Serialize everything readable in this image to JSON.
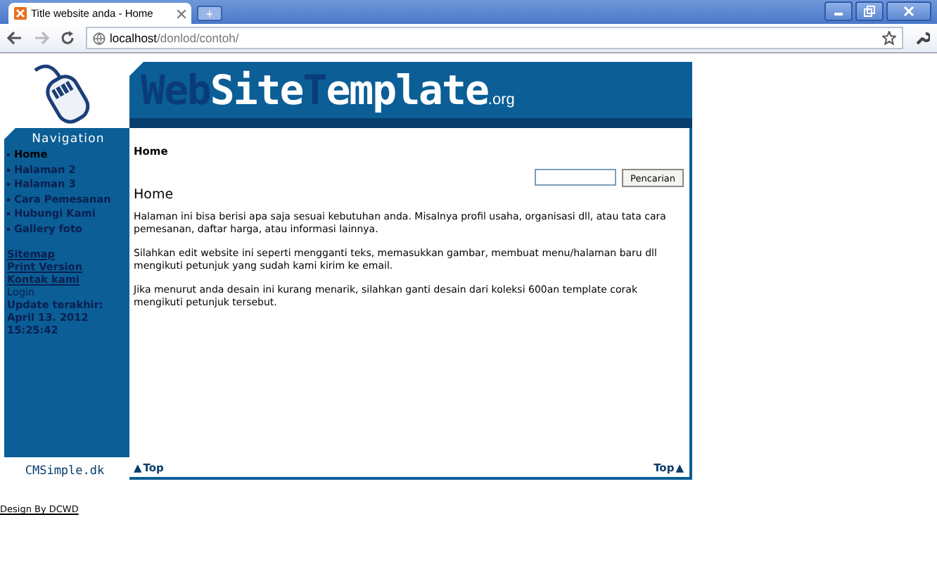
{
  "browser": {
    "tab_title": "Title website anda - Home",
    "new_tab": "+",
    "address_host": "localhost",
    "address_path": "/donlod/contoh/"
  },
  "header": {
    "title_segments": [
      {
        "text": "Web",
        "accent": true
      },
      {
        "text": "Site",
        "accent": false
      },
      {
        "text": "T",
        "accent": true
      },
      {
        "text": "emplate",
        "accent": false
      }
    ],
    "suffix": ".org"
  },
  "navigation": {
    "heading": "Navigation",
    "items": [
      {
        "label": "Home",
        "selected": true
      },
      {
        "label": "Halaman 2",
        "selected": false
      },
      {
        "label": "Halaman 3",
        "selected": false
      },
      {
        "label": "Cara Pemesanan",
        "selected": false
      },
      {
        "label": "Hubungi Kami",
        "selected": false
      },
      {
        "label": "Gallery foto",
        "selected": false
      }
    ]
  },
  "side_links": [
    {
      "label": "Sitemap",
      "kind": "link"
    },
    {
      "label": "Print Version",
      "kind": "link"
    },
    {
      "label": "Kontak kami",
      "kind": "link"
    },
    {
      "label": "Login",
      "kind": "plain"
    }
  ],
  "update": {
    "label": "Update terakhir:",
    "date": "April 13. 2012",
    "time": "15:25:42"
  },
  "breadcrumb": "Home",
  "search": {
    "button": "Pencarian"
  },
  "content": {
    "heading": "Home",
    "paragraphs": [
      "Halaman ini bisa berisi apa saja sesuai kebutuhan anda. Misalnya profil usaha, organisasi dll, atau tata cara pemesanan, daftar harga, atau informasi lainnya.",
      "Silahkan edit website ini seperti mengganti teks, memasukkan gambar, membuat menu/halaman baru dll mengikuti petunjuk yang sudah kami kirim ke email.",
      "Jika menurut anda desain ini kurang menarik, silahkan ganti desain dari koleksi 600an template corak mengikuti petunjuk tersebut."
    ]
  },
  "footer": {
    "powered": "CMSimple.dk",
    "top_left": "Top",
    "top_right": "Top",
    "top_arrow": "▲",
    "design": "Design By DCWD"
  }
}
